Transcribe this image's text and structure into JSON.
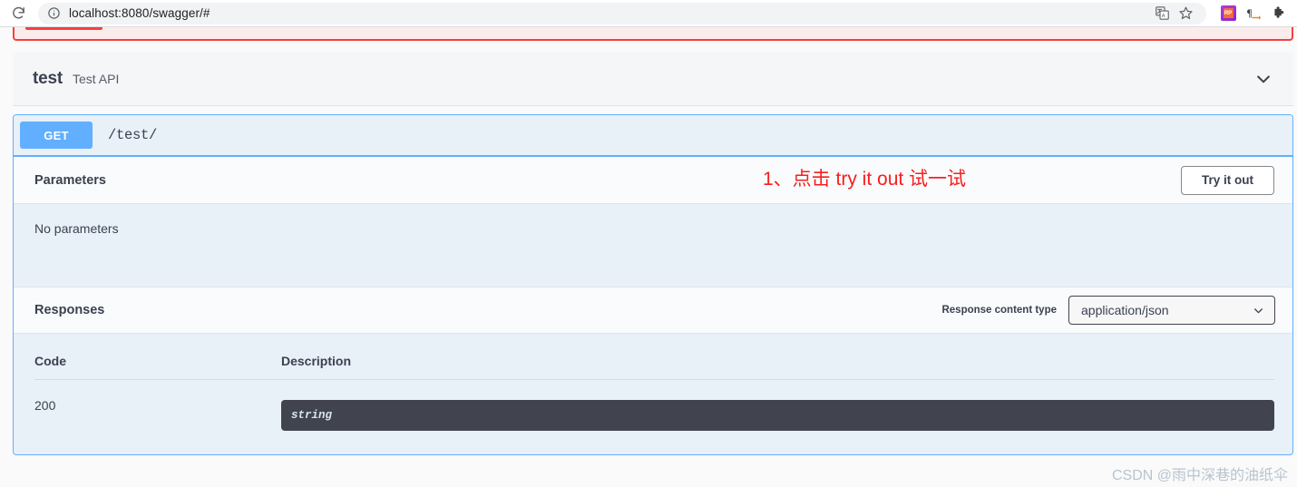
{
  "browser": {
    "url": "localhost:8080/swagger/#",
    "reload_icon": "reload-icon",
    "site_info_icon": "site-info-icon",
    "translate_icon": "translate-icon",
    "bookmark_icon": "bookmark-star-icon",
    "extension_rp_icon": "rp-extension-icon",
    "extension_rp_label": "RP",
    "extension_pilcrow_icon": "pilcrow-arrow-icon",
    "extensions_icon": "puzzle-piece-icon"
  },
  "alert": {
    "present": true,
    "border_color": "#f93e3e",
    "background_color": "#fbecec"
  },
  "tag": {
    "name": "test",
    "description": "Test API",
    "collapse_icon": "chevron-down-icon"
  },
  "operation": {
    "method": "GET",
    "path": "/test/",
    "method_color": "#61affe",
    "border_color": "#61affe",
    "background_color": "#e8f0f8",
    "parameters": {
      "title": "Parameters",
      "empty_text": "No parameters",
      "try_it_out_label": "Try it out"
    },
    "annotation": {
      "text": "1、点击 try it out 试一试",
      "color": "#f81e1e"
    },
    "responses": {
      "title": "Responses",
      "content_type_label": "Response content type",
      "content_type_value": "application/json",
      "content_type_options": [
        "application/json"
      ],
      "chevron_icon": "chevron-down-icon",
      "columns": [
        "Code",
        "Description"
      ],
      "rows": [
        {
          "code": "200",
          "description_code": "string"
        }
      ]
    }
  },
  "watermark": {
    "text": "CSDN @雨中深巷的油纸伞"
  }
}
